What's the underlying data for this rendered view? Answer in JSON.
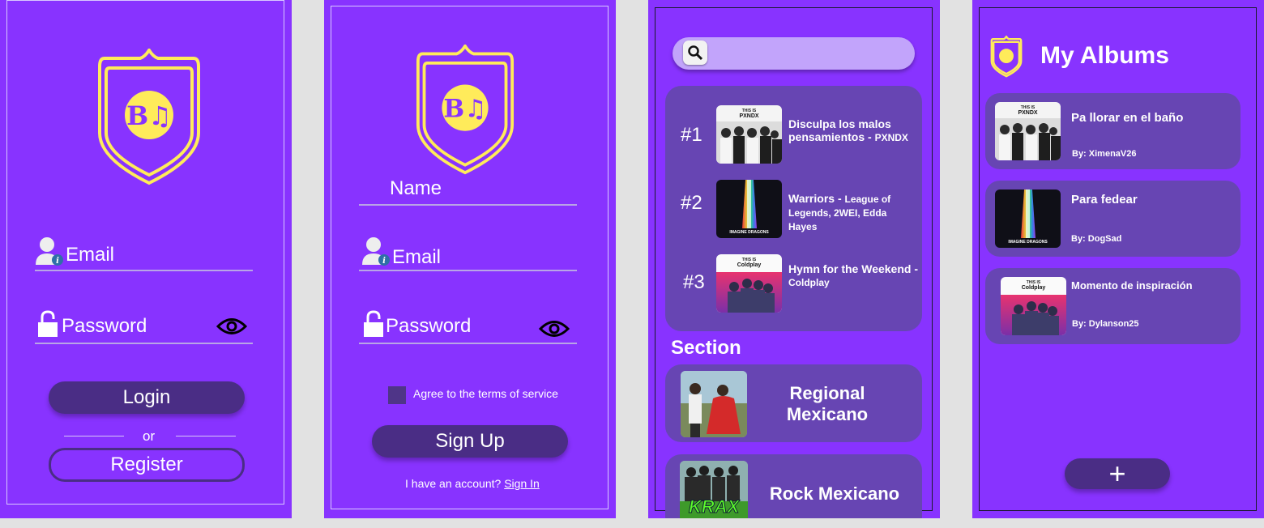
{
  "colors": {
    "screen_bg": "#8833ff",
    "button_dark": "#4a2d85",
    "card_bg": "#6745b3",
    "accent_yellow": "#ffeb5a",
    "search_bg": "#c2a4fb"
  },
  "login": {
    "email_label": "Email",
    "password_label": "Password",
    "login_button": "Login",
    "or_text": "or",
    "register_button": "Register",
    "icons": [
      "app-logo-shield",
      "user-info-icon",
      "lock-icon",
      "eye-icon"
    ]
  },
  "signup": {
    "name_label": "Name",
    "email_label": "Email",
    "password_label": "Password",
    "terms_text": "Agree to the terms of service",
    "signup_button": "Sign Up",
    "have_account_text": "I have an account?",
    "signin_link": "Sign In"
  },
  "browse": {
    "search_value": "",
    "top_songs": [
      {
        "rank": "#1",
        "title": "Disculpa los malos pensamientos -",
        "artist": "PXNDX",
        "cover_caption": "THIS IS",
        "cover_name": "PXNDX"
      },
      {
        "rank": "#2",
        "title": "Warriors -",
        "artist": "League of Legends, 2WEI, Edda Hayes",
        "cover_caption": "IMAGINE DRAGONS",
        "cover_name": ""
      },
      {
        "rank": "#3",
        "title": "Hymn for the Weekend -",
        "artist": "Coldplay",
        "cover_caption": "THIS IS",
        "cover_name": "Coldplay"
      }
    ],
    "section_title": "Section",
    "genres": [
      {
        "label": "Regional Mexicano"
      },
      {
        "label": "Rock Mexicano",
        "cover_text": "KRAX"
      }
    ]
  },
  "albums": {
    "title": "My Albums",
    "items": [
      {
        "title": "Pa llorar en el baño",
        "by": "By: XimenaV26",
        "cover_caption": "THIS IS",
        "cover_name": "PXNDX"
      },
      {
        "title": "Para fedear",
        "by": "By: DogSad",
        "cover_caption": "IMAGINE DRAGONS",
        "cover_name": ""
      },
      {
        "title": "Momento de inspiración",
        "by": "By: Dylanson25",
        "cover_caption": "THIS IS",
        "cover_name": "Coldplay"
      }
    ],
    "add_button": "+"
  }
}
